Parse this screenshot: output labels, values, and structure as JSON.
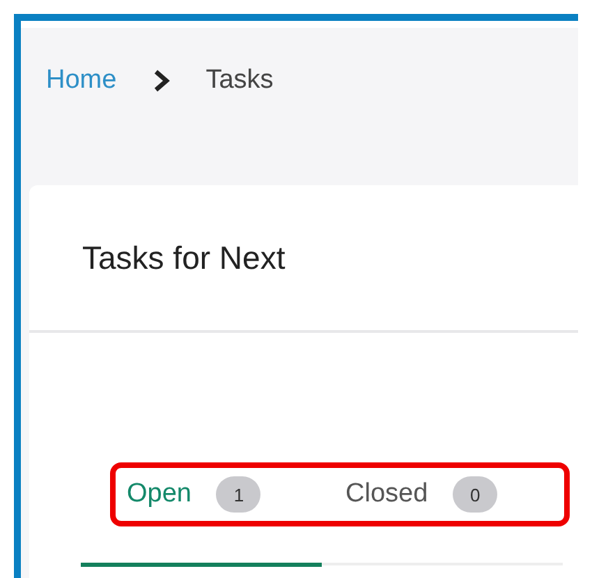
{
  "breadcrumb": [
    {
      "label": "Home",
      "kind": "link"
    },
    {
      "label": "Tasks",
      "kind": "current"
    }
  ],
  "card": {
    "title": "Tasks for Next"
  },
  "tabs": [
    {
      "label": "Open",
      "count": "1",
      "selected": true
    },
    {
      "label": "Closed",
      "count": "0",
      "selected": false
    }
  ]
}
